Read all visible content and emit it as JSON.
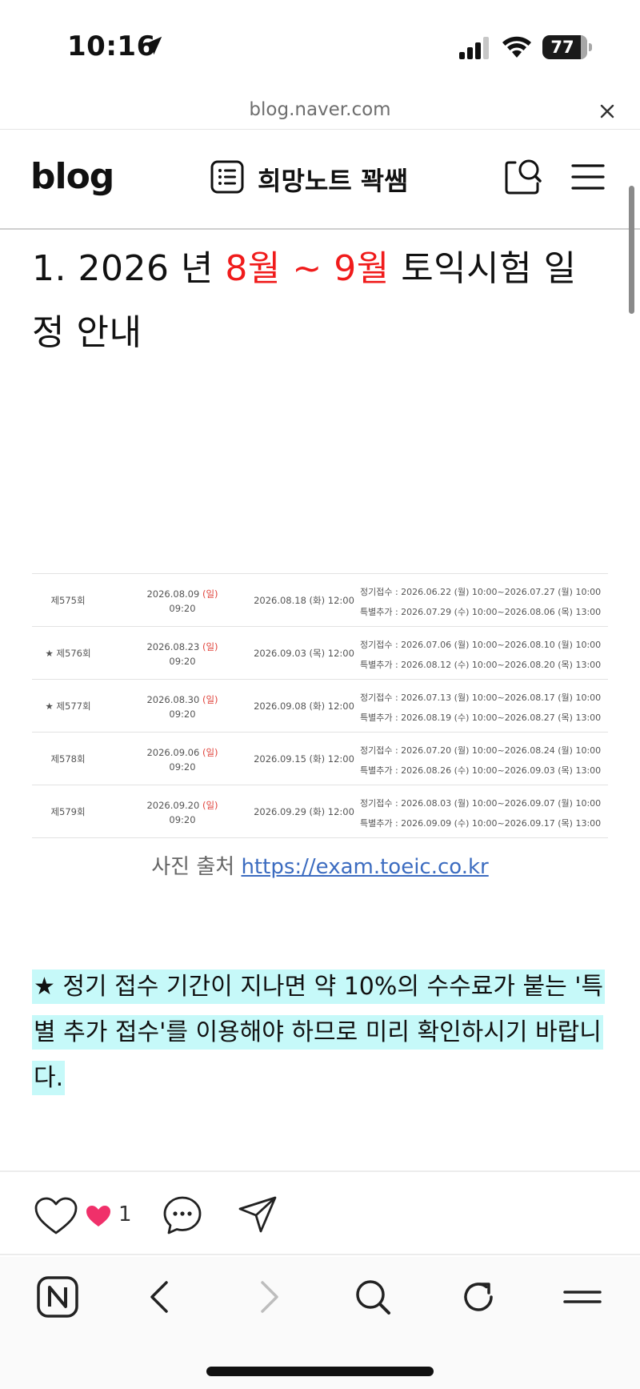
{
  "status_bar": {
    "time": "10:16",
    "battery": "77",
    "icons": [
      "location-arrow-icon",
      "cellular-signal-icon",
      "wifi-icon",
      "battery-icon"
    ]
  },
  "url_bar": {
    "url": "blog.naver.com"
  },
  "blog_header": {
    "logo": "blog",
    "blog_title": "희망노트 꽉쌤"
  },
  "article": {
    "heading": {
      "prefix": "1. 2026 년 ",
      "highlight": "8월 ~ 9월",
      "suffix": " 토익시험 일정 안내"
    },
    "schedule": [
      {
        "round": "제575회",
        "test_date": "2026.08.09",
        "test_day": "(일)",
        "test_time": "09:20",
        "result": "2026.08.18 (화) 12:00",
        "regular": "정기접수 : 2026.06.22 (월) 10:00~2026.07.27 (월) 10:00",
        "special": "특별추가 : 2026.07.29 (수) 10:00~2026.08.06 (목) 13:00"
      },
      {
        "round": "★ 제576회",
        "test_date": "2026.08.23",
        "test_day": "(일)",
        "test_time": "09:20",
        "result": "2026.09.03 (목) 12:00",
        "regular": "정기접수 : 2026.07.06 (월) 10:00~2026.08.10 (월) 10:00",
        "special": "특별추가 : 2026.08.12 (수) 10:00~2026.08.20 (목) 13:00"
      },
      {
        "round": "★ 제577회",
        "test_date": "2026.08.30",
        "test_day": "(일)",
        "test_time": "09:20",
        "result": "2026.09.08 (화) 12:00",
        "regular": "정기접수 : 2026.07.13 (월) 10:00~2026.08.17 (월) 10:00",
        "special": "특별추가 : 2026.08.19 (수) 10:00~2026.08.27 (목) 13:00"
      },
      {
        "round": "제578회",
        "test_date": "2026.09.06",
        "test_day": "(일)",
        "test_time": "09:20",
        "result": "2026.09.15 (화) 12:00",
        "regular": "정기접수 : 2026.07.20 (월) 10:00~2026.08.24 (월) 10:00",
        "special": "특별추가 : 2026.08.26 (수) 10:00~2026.09.03 (목) 13:00"
      },
      {
        "round": "제579회",
        "test_date": "2026.09.20",
        "test_day": "(일)",
        "test_time": "09:20",
        "result": "2026.09.29 (화) 12:00",
        "regular": "정기접수 : 2026.08.03 (월) 10:00~2026.09.07 (월) 10:00",
        "special": "특별추가 : 2026.09.09 (수) 10:00~2026.09.17 (목) 13:00"
      }
    ],
    "caption_prefix": "사진 출처 ",
    "caption_link": "https://exam.toeic.co.kr",
    "note": "★ 정기 접수 기간이 지나면 약 10%의 수수료가 붙는 '특별 추가 접수'를 이용해야 하므로 미리 확인하시기 바랍니다. "
  },
  "reactions": {
    "like_count": "1"
  },
  "colors": {
    "heading_highlight": "#f01b1b",
    "note_highlight": "#c6f9f9",
    "link": "#3c6cc0",
    "heart": "#f0306a"
  }
}
